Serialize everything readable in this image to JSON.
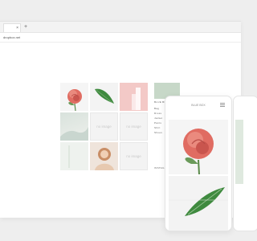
{
  "browser": {
    "tab_close": "×",
    "new_tab": "+",
    "url": "dropbox.net"
  },
  "grid": {
    "no_image_label": "no image"
  },
  "info_panel": {
    "title": "BLUE BOX",
    "lines": [
      "Bag",
      "Dress",
      "Jacket",
      "Pants",
      "Shirt",
      "Shoes"
    ],
    "footer": "INSTAGRAM"
  },
  "phone": {
    "title": "BLUE BOX"
  },
  "colors": {
    "rose": "#e06c62",
    "pink_bg": "#f3c9c7",
    "leaf": "#3f8a3f"
  }
}
